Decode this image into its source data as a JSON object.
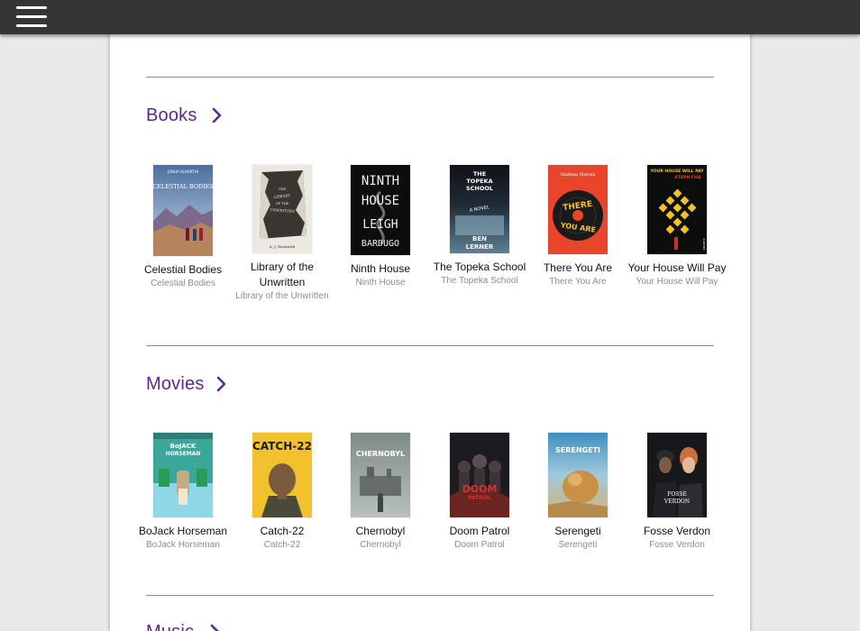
{
  "sections": {
    "books": {
      "title": "Books",
      "items": [
        {
          "title": "Celestial Bodies",
          "subtitle": "Celestial Bodies",
          "cover_text": "CELESTIAL BODIES",
          "cover_top": "JOKHA ALHARTHI"
        },
        {
          "title": "Library of the Unwritten",
          "subtitle": "Library of the Unwritten",
          "cover_text": "THE LIBRARY OF THE UNWRITTEN",
          "cover_bottom": "A. J. Hackwith"
        },
        {
          "title": "Ninth House",
          "subtitle": "Ninth House",
          "cover_line1": "NINTH",
          "cover_line2": "HOUSE",
          "cover_line3": "LEIGH",
          "cover_line4": "BARDUGO"
        },
        {
          "title": "The Topeka School",
          "subtitle": "The Topeka School",
          "cover_line1": "THE",
          "cover_line2": "TOPEKA",
          "cover_line3": "SCHOOL",
          "cover_mid": "A NOVEL",
          "cover_line4": "BEN",
          "cover_line5": "LERNER"
        },
        {
          "title": "There You Are",
          "subtitle": "There You Are",
          "cover_top": "Mathea Morais",
          "cover_line1": "THERE",
          "cover_line2": "YOU ARE"
        },
        {
          "title": "Your House Will Pay",
          "subtitle": "Your House Will Pay",
          "cover_line1": "YOUR HOUSE WILL PAY",
          "cover_line2": "STEPH CHA",
          "cover_side": "A NOVEL"
        }
      ]
    },
    "movies": {
      "title": "Movies",
      "items": [
        {
          "title": "BoJack Horseman",
          "subtitle": "BoJack Horseman",
          "cover_line1": "BoJACK",
          "cover_line2": "HORSEMAN"
        },
        {
          "title": "Catch-22",
          "subtitle": "Catch-22",
          "cover_line1": "CATCH-22"
        },
        {
          "title": "Chernobyl",
          "subtitle": "Chernobyl",
          "cover_line1": "CHERNOBYL"
        },
        {
          "title": "Doom Patrol",
          "subtitle": "Doom Patrol",
          "cover_line1": "DOOM",
          "cover_line2": "PATROL"
        },
        {
          "title": "Serengeti",
          "subtitle": "Serengeti",
          "cover_line1": "SERENGETI"
        },
        {
          "title": "Fosse Verdon",
          "subtitle": "Fosse Verdon",
          "cover_line1": "FOSSE",
          "cover_line2": "VERDON"
        }
      ]
    },
    "music": {
      "title": "Music"
    }
  },
  "colors": {
    "accent": "#5b2a86",
    "topbar": "#353535",
    "rule": "#8a8a8a"
  },
  "icons": {
    "menu": "hamburger-icon",
    "section_more": "chevron-right-icon"
  }
}
